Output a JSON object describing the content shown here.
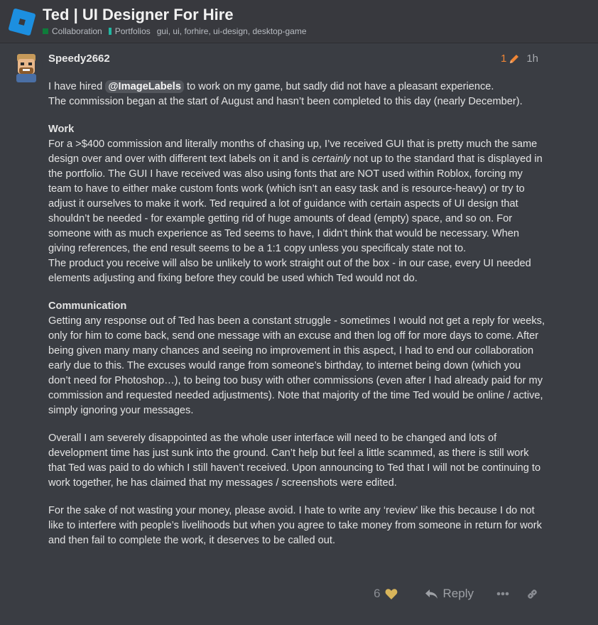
{
  "topic": {
    "title": "Ted | UI Designer For Hire",
    "categories": [
      {
        "label": "Collaboration",
        "color": "#0e7c3a"
      },
      {
        "label": "Portfolios",
        "color": "#21b7a2"
      }
    ],
    "tags": "gui, ui, forhire, ui-design, desktop-game"
  },
  "post": {
    "username": "Speedy2662",
    "edit_count": "1",
    "time": "1h",
    "intro_1": "I have hired ",
    "mention": "@ImageLabels",
    "intro_2": " to work on my game, but sadly did not have a pleasant experience.",
    "intro_3": "The commission began at the start of August and hasn’t been completed to this day (nearly December).",
    "work_heading": "Work",
    "work_1": "For a >$400 commission and literally months of chasing up, I’ve received GUI that is pretty much the same design over and over with different text labels on it and is ",
    "work_em": "certainly",
    "work_2": " not up to the standard that is displayed in the portfolio. The GUI I have received was also using fonts that are NOT used within Roblox, forcing my team to have to either make custom fonts work (which isn’t an easy task and is resource-heavy) or try to adjust it ourselves to make it work. Ted required a lot of guidance with certain aspects of UI design that shouldn’t be needed - for example getting rid of huge amounts of dead (empty) space, and so on. For someone with as much experience as Ted seems to have, I didn’t think that would be necessary. When giving references, the end result seems to be a 1:1 copy unless you specificaly state not to.",
    "work_3": "The product you receive will also be unlikely to work straight out of the box - in our case, every UI needed elements adjusting and fixing before they could be used which Ted would not do.",
    "comm_heading": "Communication",
    "comm_1": "Getting any response out of Ted has been a constant struggle - sometimes I would not get a reply for weeks, only for him to come back, send one message with an excuse and then log off for more days to come. After being given many many chances and seeing no improvement in this aspect, I had to end our collaboration early due to this. The excuses would range from someone’s birthday, to internet being down (which you don’t need for Photoshop…), to being too busy with other commissions (even after I had already paid for my commission and requested needed adjustments). Note that majority of the time Ted would be online / active, simply ignoring your messages.",
    "overall": "Overall I am severely disappointed as the whole user interface will need to be changed and lots of development time has just sunk into the ground. Can’t help but feel a little scammed, as there is still work that Ted was paid to do which I still haven’t received. Upon announcing to Ted that I will not be continuing to work together, he has claimed that my messages / screenshots were edited.",
    "closing": "For the sake of not wasting your money, please avoid. I hate to write any ‘review’ like this because I do not like to interfere with people’s livelihoods but when you agree to take money from someone in return for work and then fail to complete the work, it deserves to be called out."
  },
  "actions": {
    "like_count": "6",
    "reply_label": "Reply",
    "icons": [
      "heart-icon",
      "reply-icon",
      "more-icon",
      "link-icon"
    ]
  },
  "colors": {
    "background": "#3a3d43",
    "header": "#38393e",
    "edit_accent": "#ef8535",
    "heart": "#d8b55b",
    "logo": "#1c8fe0"
  }
}
